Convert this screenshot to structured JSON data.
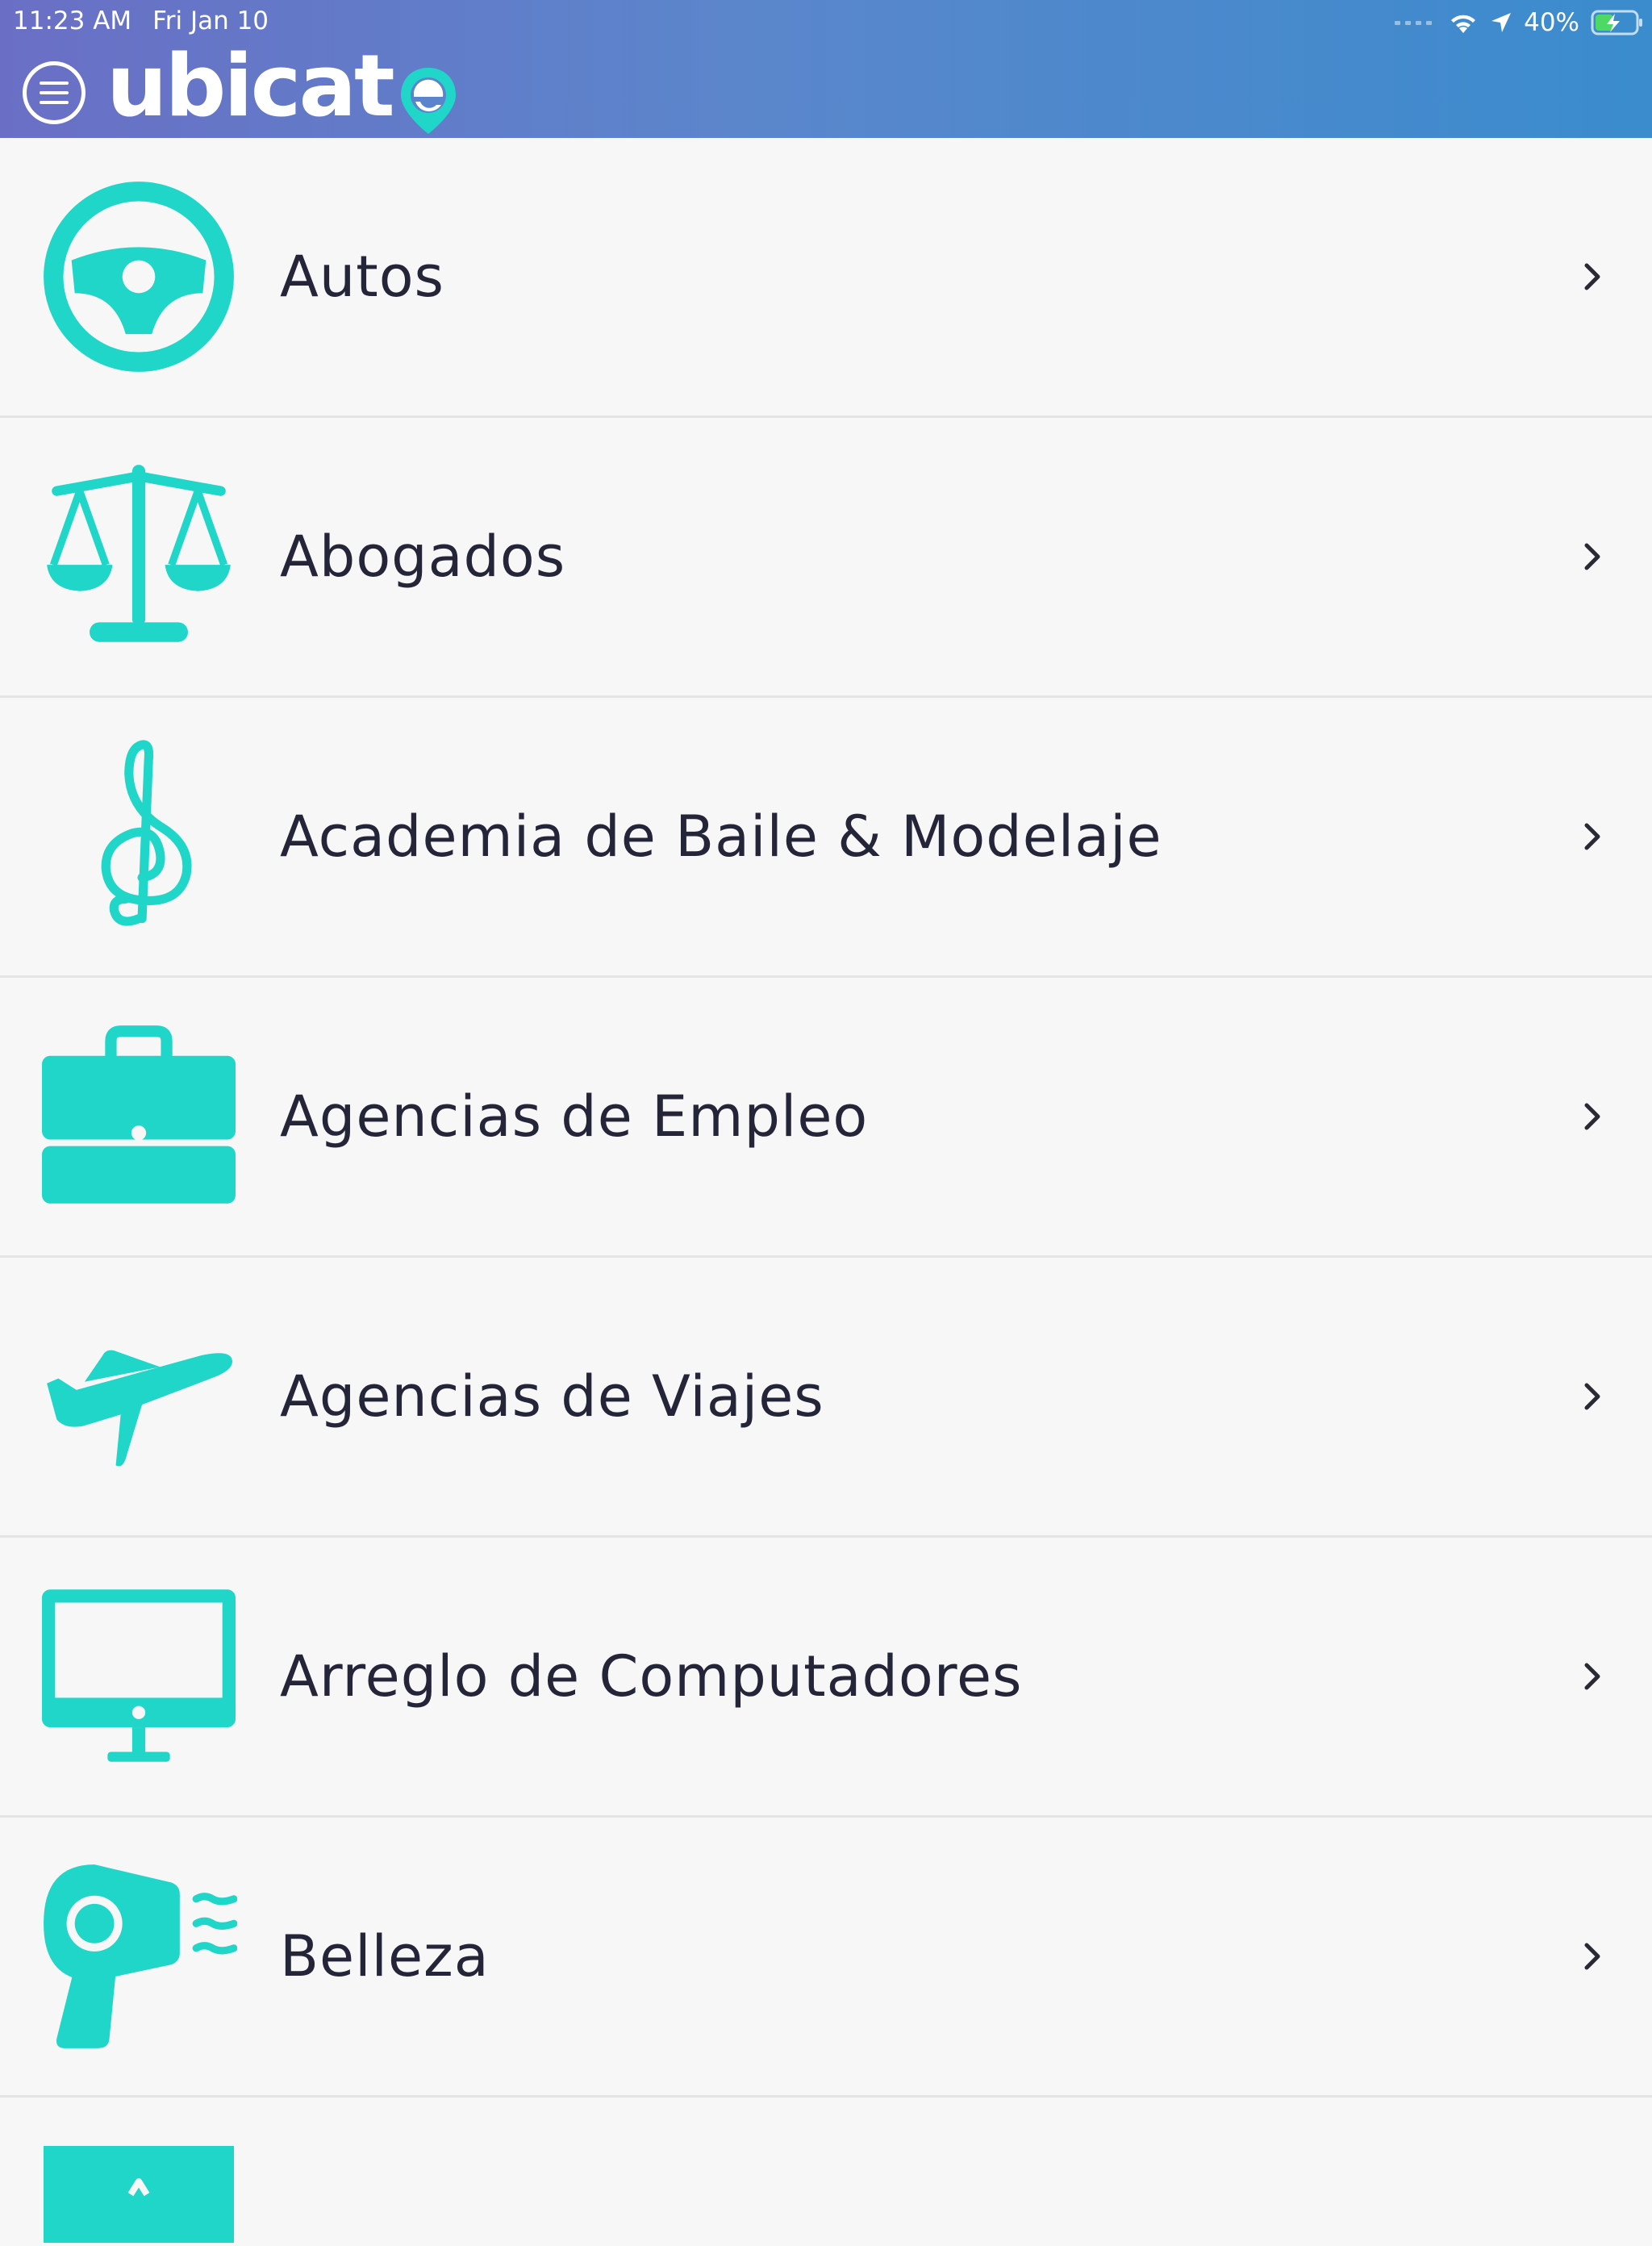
{
  "status_bar": {
    "time": "11:23 AM",
    "date": "Fri Jan 10",
    "battery": "40%"
  },
  "header": {
    "logo_text": "ubicat",
    "logo_suffix": "e",
    "menu_icon": "hamburger-menu-icon"
  },
  "colors": {
    "accent": "#1fd6c9",
    "header_start": "#6a6fc5",
    "header_end": "#3a8ccd",
    "text": "#25253a"
  },
  "categories": [
    {
      "label": "Autos",
      "icon": "steering-wheel-icon"
    },
    {
      "label": "Abogados",
      "icon": "scales-icon"
    },
    {
      "label": "Academia de Baile & Modelaje",
      "icon": "treble-clef-icon"
    },
    {
      "label": "Agencias de Empleo",
      "icon": "briefcase-icon"
    },
    {
      "label": "Agencias de Viajes",
      "icon": "airplane-icon"
    },
    {
      "label": "Arreglo de Computadores",
      "icon": "monitor-icon"
    },
    {
      "label": "Belleza",
      "icon": "hair-dryer-icon"
    }
  ]
}
